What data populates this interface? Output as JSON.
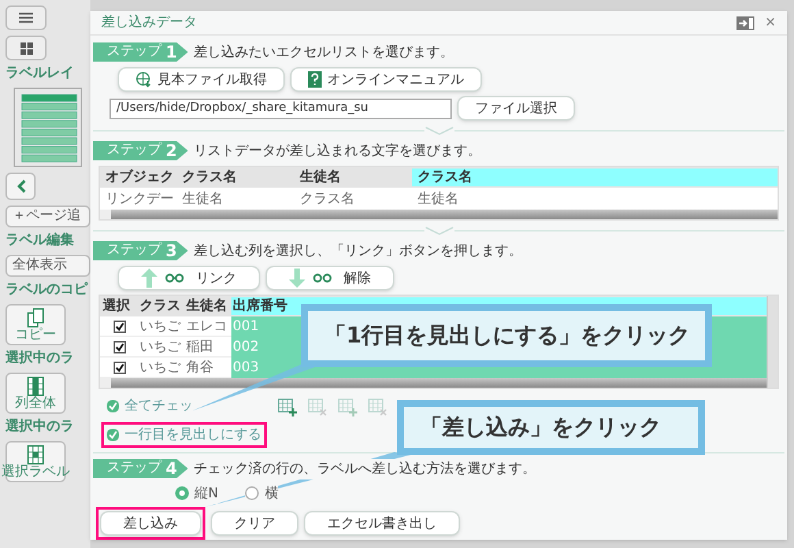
{
  "sidebar": {
    "items": [
      {
        "kind": "menu"
      },
      {
        "kind": "grid"
      },
      {
        "kind": "heading",
        "label": "ラベルレイ"
      },
      {
        "kind": "thumbnail"
      },
      {
        "kind": "back"
      },
      {
        "kind": "button",
        "label": "＋ページ追"
      },
      {
        "kind": "heading",
        "label": "ラベル編集"
      },
      {
        "kind": "button",
        "label": "全体表示"
      },
      {
        "kind": "heading",
        "label": "ラベルのコピ"
      },
      {
        "kind": "copy",
        "label": "コピー"
      },
      {
        "kind": "heading",
        "label": "選択中のラ"
      },
      {
        "kind": "column",
        "label": "列全体"
      },
      {
        "kind": "heading",
        "label": "選択中のラ"
      },
      {
        "kind": "cell",
        "label": "選択ラベル"
      }
    ]
  },
  "dialog": {
    "title": "差し込みデータ",
    "close": "×"
  },
  "step1": {
    "badge": "ステップ",
    "number": "1",
    "text": "差し込みたいエクセルリストを選びます。",
    "buttons": [
      {
        "kind": "download",
        "label": "見本ファイル取得"
      },
      {
        "kind": "help",
        "label": "オンラインマニュアル"
      }
    ],
    "file_path": "/Users/hide/Dropbox/_share_kitamura_su",
    "file_button": "ファイル選択"
  },
  "step2": {
    "badge": "ステップ",
    "number": "2",
    "text": "リストデータが差し込まれる文字を選びます。",
    "table": {
      "columns": [
        {
          "label": "オブジェク",
          "selected": false
        },
        {
          "label": "クラス名",
          "selected": false
        },
        {
          "label": "生徒名",
          "selected": false
        },
        {
          "label": "クラス名",
          "selected": true
        }
      ],
      "rows": [
        [
          "リンクデー",
          "生徒名",
          "クラス名",
          "生徒名"
        ]
      ]
    }
  },
  "step3": {
    "badge": "ステップ",
    "number": "3",
    "text": "差し込む列を選択し、「リンク」ボタンを押します。",
    "buttons": [
      {
        "kind": "link",
        "label": "リンク"
      },
      {
        "kind": "unlink",
        "label": "解除"
      }
    ],
    "table": {
      "select_header": "選択",
      "columns": [
        {
          "label": "クラス",
          "selected": false
        },
        {
          "label": "生徒名",
          "selected": false
        },
        {
          "label": "出席番号",
          "selected": true
        }
      ],
      "rows": [
        {
          "checked": true,
          "cells": [
            "いちご",
            "エレコ",
            "001"
          ]
        },
        {
          "checked": true,
          "cells": [
            "いちご",
            "稲田",
            "002"
          ]
        },
        {
          "checked": true,
          "cells": [
            "いちご",
            "角谷",
            "003"
          ]
        }
      ]
    },
    "options": [
      {
        "label": "全てチェッ",
        "checked": true,
        "highlighted": false
      },
      {
        "label": "一行目を見出しにする",
        "checked": true,
        "highlighted": true
      }
    ]
  },
  "step4": {
    "badge": "ステップ",
    "number": "4",
    "text": "チェック済の行の、ラベルへ差し込む方法を選びます。",
    "radios": [
      {
        "label": "縦N",
        "selected": true
      },
      {
        "label": "横",
        "selected": false
      }
    ],
    "buttons": [
      {
        "label": "差し込み",
        "highlighted": true
      },
      {
        "label": "クリア",
        "highlighted": false
      },
      {
        "label": "エクセル書き出し",
        "highlighted": false
      }
    ]
  },
  "callouts": [
    {
      "text": "「1行目を見出しにする」をクリック"
    },
    {
      "text": "「差し込み」をクリック"
    }
  ]
}
